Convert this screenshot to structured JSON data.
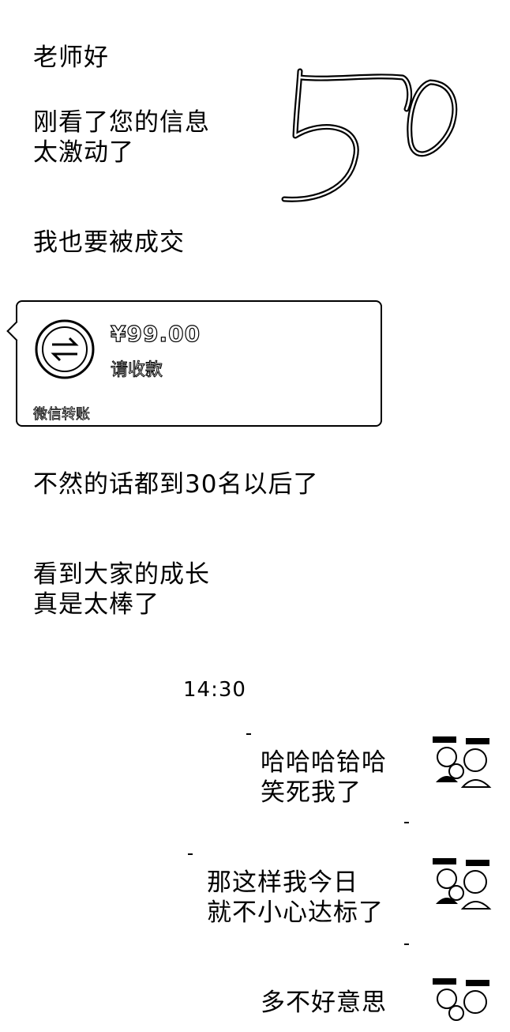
{
  "messages_left": {
    "m1": "老师好",
    "m2_l1": "刚看了您的信息",
    "m2_l2": "太激动了",
    "m3": "我也要被成交",
    "m4": "不然的话都到30名以后了",
    "m5_l1": "看到大家的成长",
    "m5_l2": "真是太棒了"
  },
  "handwriting_text": "50",
  "transfer": {
    "amount": "¥99.00",
    "description": "请收款",
    "footer": "微信转账"
  },
  "timestamp": "14:30",
  "messages_right": {
    "r1_l1": "哈哈哈铪哈",
    "r1_l2": "笑死我了",
    "r2_l1": "那这样我今日",
    "r2_l2": "就不小心达标了",
    "r3_l1": "多不好意思"
  },
  "icons": {
    "transfer": "transfer-arrows-icon",
    "avatar": "cartoon-family-avatar"
  }
}
